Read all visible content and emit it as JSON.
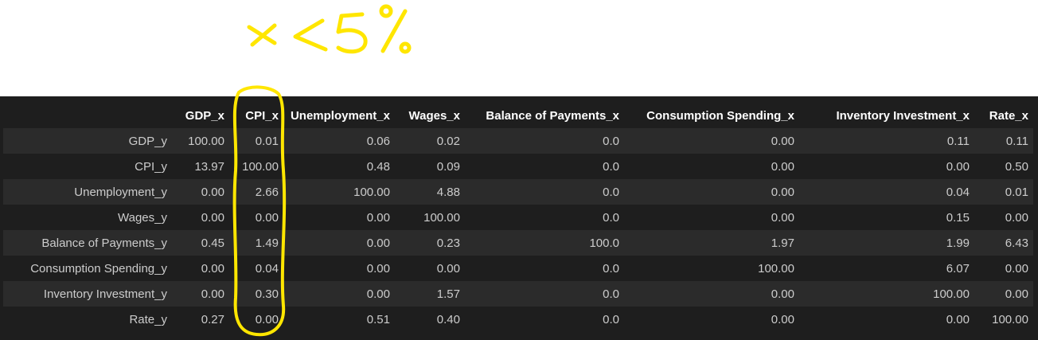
{
  "annotation": {
    "text": "x<5%",
    "color": "#ffe600"
  },
  "table": {
    "columns": [
      "GDP_x",
      "CPI_x",
      "Unemployment_x",
      "Wages_x",
      "Balance of Payments_x",
      "Consumption Spending_x",
      "Inventory Investment_x",
      "Rate_x"
    ],
    "rows": [
      {
        "label": "GDP_y",
        "values": [
          "100.00",
          "0.01",
          "0.06",
          "0.02",
          "0.0",
          "0.00",
          "0.11",
          "0.11"
        ]
      },
      {
        "label": "CPI_y",
        "values": [
          "13.97",
          "100.00",
          "0.48",
          "0.09",
          "0.0",
          "0.00",
          "0.00",
          "0.50"
        ]
      },
      {
        "label": "Unemployment_y",
        "values": [
          "0.00",
          "2.66",
          "100.00",
          "4.88",
          "0.0",
          "0.00",
          "0.04",
          "0.01"
        ]
      },
      {
        "label": "Wages_y",
        "values": [
          "0.00",
          "0.00",
          "0.00",
          "100.00",
          "0.0",
          "0.00",
          "0.15",
          "0.00"
        ]
      },
      {
        "label": "Balance of Payments_y",
        "values": [
          "0.45",
          "1.49",
          "0.00",
          "0.23",
          "100.0",
          "1.97",
          "1.99",
          "6.43"
        ]
      },
      {
        "label": "Consumption Spending_y",
        "values": [
          "0.00",
          "0.04",
          "0.00",
          "0.00",
          "0.0",
          "100.00",
          "6.07",
          "0.00"
        ]
      },
      {
        "label": "Inventory Investment_y",
        "values": [
          "0.00",
          "0.30",
          "0.00",
          "1.57",
          "0.0",
          "0.00",
          "100.00",
          "0.00"
        ]
      },
      {
        "label": "Rate_y",
        "values": [
          "0.27",
          "0.00",
          "0.51",
          "0.40",
          "0.0",
          "0.00",
          "0.00",
          "100.00"
        ]
      }
    ]
  },
  "colors": {
    "panel_bg": "#1e1e1e",
    "row_stripe": "#2b2b2b",
    "header_text": "#ffffff",
    "cell_text": "#cccccc",
    "highlight": "#ffe600"
  }
}
